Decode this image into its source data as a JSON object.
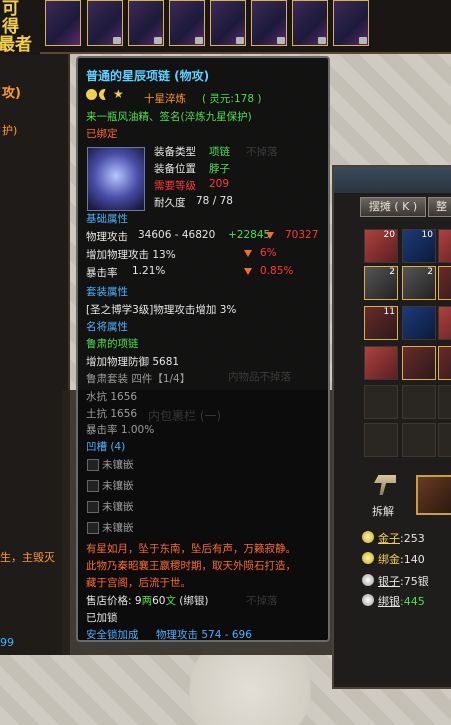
{
  "top_strip": {
    "slot_count": 8
  },
  "left_panel": {
    "chars": [
      "可",
      "得",
      "最者"
    ],
    "attack_label": "攻)",
    "protect_label": "护)",
    "lore_fragment": "生，主毁灭",
    "number_fragment": "99"
  },
  "tooltip": {
    "title": "普通的星辰项链 (物攻)",
    "refine": "十星淬炼",
    "spirit": "( 灵元:178 )",
    "refine_note": "来一瓶风油精、签名(淬炼九星保护)",
    "bound": "已绑定",
    "equip_type_label": "装备类型",
    "equip_type_value": "项链",
    "equip_pos_label": "装备位置",
    "equip_pos_value": "脖子",
    "req_level_label": "需要等级",
    "req_level_value": "209",
    "durability_label": "耐久度",
    "durability_value": "78 / 78",
    "basic_header": "基础属性",
    "phys_atk_label": "物理攻击",
    "phys_atk_value": "34606 - 46820",
    "phys_atk_bonus": "+22845",
    "phys_atk_diff": "70327",
    "phys_atk_pct_label": "增加物理攻击 13%",
    "phys_atk_pct_diff": "6%",
    "crit_label": "暴击率",
    "crit_value": "1.21%",
    "crit_diff": "0.85%",
    "set_header": "套装属性",
    "set_line": "[圣之博学3级]物理攻击增加 3%",
    "named_header": "名将属性",
    "named_name": "鲁肃的项链",
    "named_line": "增加物理防御 5681",
    "suit_line": "鲁肃套装  四件【1/4】",
    "water_res": "水抗  1656",
    "earth_res": "土抗  1656",
    "crit_rate2": "暴击率 1.00%",
    "socket_header": "凹槽 (4)",
    "sockets": [
      "未镶嵌",
      "未镶嵌",
      "未镶嵌",
      "未镶嵌"
    ],
    "lore": [
      "有星如月，坠于东南，坠后有声，万籁寂静。",
      "此物乃秦昭襄王嬴稷时期，取天外陨石打造，",
      "藏于宫阁，后流于世。"
    ],
    "price_label": "售店价格:",
    "price_value_1": "9",
    "price_unit_1": "两",
    "price_value_2": "60",
    "price_unit_2": "文",
    "price_bind": "(绑银)",
    "locked": "已加锁",
    "safe_lock": "安全锁加成",
    "safe_lock_attr": "物理攻击  574 - 696",
    "faded_1": "不掉落",
    "faded_2": "内物品不掉落",
    "faded_3": "不掉落",
    "faded_4": "内包裹栏 (一)"
  },
  "inventory": {
    "btn_stall": "摆摊 ( K )",
    "btn_other": "整",
    "counts": [
      "20",
      "10",
      "2",
      "2",
      "11"
    ],
    "disassemble": "拆解",
    "gold_label": "金子",
    "gold_value": ":253",
    "bind_gold_label": "绑金",
    "bind_gold_value": ":140",
    "silver_label": "银子",
    "silver_value": ":75银",
    "bind_silver_label": "绑银",
    "bind_silver_value": ":445"
  }
}
